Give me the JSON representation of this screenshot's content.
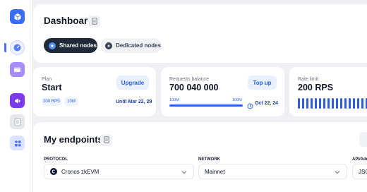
{
  "sidebar": {
    "logo_icon": "cube-logo-icon",
    "items": [
      {
        "name": "gauge-icon",
        "color": "#4f6ef7",
        "active": true
      },
      {
        "name": "wallet-icon",
        "color": "#8b5cf6"
      },
      {
        "name": "megaphone-icon",
        "color": "#7c3aed"
      },
      {
        "name": "document-icon",
        "color": "#9ca3af"
      },
      {
        "name": "grid-icon",
        "color": "#4f6ef7"
      }
    ]
  },
  "header": {
    "title": "Dashboard",
    "tabs": [
      {
        "label": "Shared nodes",
        "active": true
      },
      {
        "label": "Dedicated nodes",
        "active": false
      }
    ]
  },
  "cards": {
    "plan": {
      "label": "Plan",
      "value": "Start",
      "button": "Upgrade",
      "chips": [
        "200 RPS",
        "10M"
      ],
      "until": "Until Mar 22, 29"
    },
    "requests": {
      "label": "Requests balance",
      "value": "700 040 000",
      "button": "Top up",
      "tick_left": "100M",
      "tick_right": "100M",
      "progress": 1.0,
      "date": "Oct 22, 24"
    },
    "rate": {
      "label": "Rate limit",
      "value": "200 RPS"
    }
  },
  "endpoints": {
    "title": "My endpoints",
    "protocol_label": "PROTOCOL",
    "protocol_value": "Cronos zkEVM",
    "network_label": "NETWORK",
    "network_value": "Mainnet",
    "api_label": "API/Add",
    "api_value": "JSO"
  },
  "colors": {
    "accent": "#2563eb",
    "background": "#eef0f4",
    "active_tab": "#1f2937"
  }
}
